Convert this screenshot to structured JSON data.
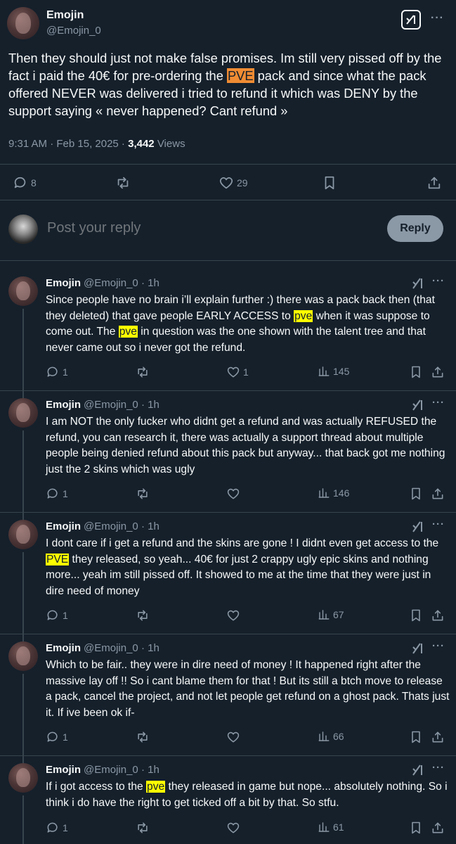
{
  "tweet": {
    "author_name": "Emojin",
    "author_handle": "@Emojin_0",
    "text_parts": [
      "Then they should just not make false promises. Im still very pissed off by the fact i paid the 40€ for pre-ordering the ",
      "PVE",
      " pack and since what the pack offered NEVER was delivered i tried to refund it which was DENY by the support saying « never happened? Cant refund »"
    ],
    "time_date": "9:31 AM · Feb 15, 2025 · ",
    "views_count": "3,442",
    "views_label": " Views",
    "replies": "8",
    "likes": "29"
  },
  "composer": {
    "placeholder": "Post your reply",
    "button": "Reply"
  },
  "replies": [
    {
      "name": "Emojin",
      "handle": "@Emojin_0 · 1h",
      "parts": [
        "Since people have no brain i’ll explain further :) there was a pack back then (that they deleted) that gave people EARLY ACCESS to ",
        "pve",
        " when it was suppose to come out. The ",
        "pve",
        " in question was the one shown with the talent tree and that never came out so i never got the refund."
      ],
      "replies": "1",
      "likes": "1",
      "views": "145"
    },
    {
      "name": "Emojin",
      "handle": "@Emojin_0 · 1h",
      "parts": [
        "I am NOT the only fucker who didnt get a refund and was actually REFUSED the refund, you can research it, there was actually a support thread about multiple people being denied refund about this pack but anyway...  that back got me nothing just the 2 skins which was ugly"
      ],
      "replies": "1",
      "likes": "",
      "views": "146"
    },
    {
      "name": "Emojin",
      "handle": "@Emojin_0 · 1h",
      "parts": [
        "I dont care if i get a refund and the skins are gone ! I didnt even get access to the ",
        "PVE",
        " they released, so yeah... 40€ for just 2 crappy ugly epic skins and nothing more... yeah im still pissed off. It showed to me at the time that they were just in dire need of money"
      ],
      "replies": "1",
      "likes": "",
      "views": "67"
    },
    {
      "name": "Emojin",
      "handle": "@Emojin_0 · 1h",
      "parts": [
        "Which to be fair.. they were in dire need of money ! It happened right after the massive lay off !! So i cant blame them for that ! But its still a btch move to release a pack, cancel the project, and not let people get refund on a ghost pack. Thats just it. If ive been ok if-"
      ],
      "replies": "1",
      "likes": "",
      "views": "66"
    },
    {
      "name": "Emojin",
      "handle": "@Emojin_0 · 1h",
      "parts": [
        "If i got access to the ",
        "pve",
        " they released in game but nope... absolutely nothing. So i think i do have the right to get ticked off a bit by that. So stfu."
      ],
      "replies": "1",
      "likes": "",
      "views": "61"
    }
  ],
  "colors": {
    "background": "#15202b",
    "highlight_orange": "#f08c33",
    "highlight_yellow": "#ffff00",
    "muted": "#8b98a5"
  }
}
